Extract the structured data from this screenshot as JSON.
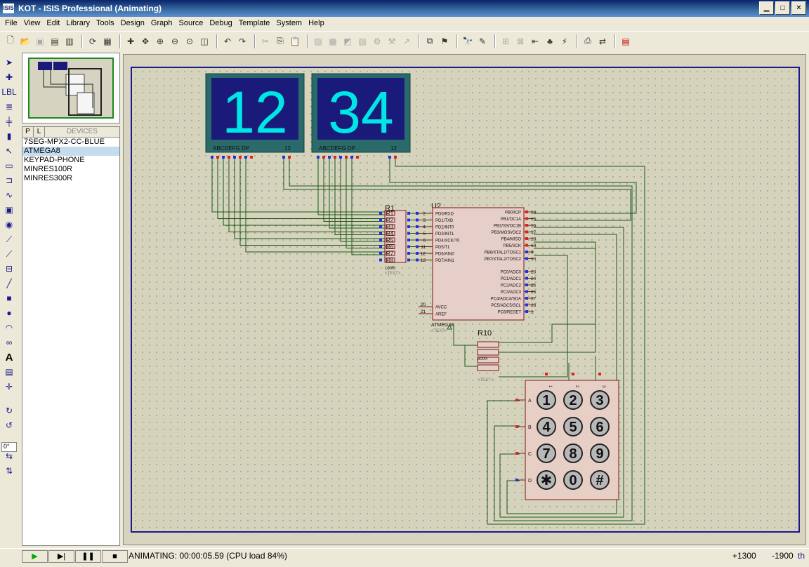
{
  "window": {
    "title": "KOT - ISIS Professional (Animating)",
    "app_icon_text": "ISIS"
  },
  "menu": [
    "File",
    "View",
    "Edit",
    "Library",
    "Tools",
    "Design",
    "Graph",
    "Source",
    "Debug",
    "Template",
    "System",
    "Help"
  ],
  "device_panel": {
    "tab_p": "P",
    "tab_l": "L",
    "header": "DEVICES",
    "items": [
      "7SEG-MPX2-CC-BLUE",
      "ATMEGA8",
      "KEYPAD-PHONE",
      "MINRES100R",
      "MINRES300R"
    ],
    "selected": "ATMEGA8"
  },
  "rotation": "0°",
  "schematic": {
    "display1_digits": "12",
    "display2_digits": "34",
    "display_pin_label": "ABCDEFG  DP",
    "display_pin_label2": "12",
    "r1_label": "R1",
    "r_pins": [
      "R1",
      "R2",
      "R3",
      "R4",
      "R5",
      "R6",
      "R7",
      "R8"
    ],
    "r1_value": "100R",
    "u2_label": "U2",
    "u2_part": "ATMEGA8",
    "text_placeholder": "<TEXT>",
    "r10_label": "R10",
    "r10_value": "300R",
    "left_pins": [
      {
        "num": "2",
        "name": "PD0/RXD"
      },
      {
        "num": "3",
        "name": "PD1/TXD"
      },
      {
        "num": "4",
        "name": "PD2/INT0"
      },
      {
        "num": "5",
        "name": "PD3/INT1"
      },
      {
        "num": "6",
        "name": "PD4/XCK/T0"
      },
      {
        "num": "11",
        "name": "PD5/T1"
      },
      {
        "num": "12",
        "name": "PD6/AIN0"
      },
      {
        "num": "13",
        "name": "PD7/AIN1"
      }
    ],
    "power_pins": [
      {
        "num": "20",
        "name": "AVCC"
      },
      {
        "num": "21",
        "name": "AREF"
      }
    ],
    "right_pins": [
      {
        "num": "14",
        "name": "PB0/ICP"
      },
      {
        "num": "15",
        "name": "PB1/OC1A"
      },
      {
        "num": "16",
        "name": "PB2/SS/OC1B"
      },
      {
        "num": "17",
        "name": "PB3/MOSI/OC2"
      },
      {
        "num": "18",
        "name": "PB4/MISO"
      },
      {
        "num": "19",
        "name": "PB5/SCK"
      },
      {
        "num": "9",
        "name": "PB6/XTAL1/TOSC1"
      },
      {
        "num": "10",
        "name": "PB7/XTAL2/TOSC2"
      },
      {
        "num": "23",
        "name": "PC0/ADC0"
      },
      {
        "num": "24",
        "name": "PC1/ADC1"
      },
      {
        "num": "25",
        "name": "PC2/ADC2"
      },
      {
        "num": "26",
        "name": "PC3/ADC3"
      },
      {
        "num": "27",
        "name": "PC4/ADC4/SDA"
      },
      {
        "num": "28",
        "name": "PC5/ADC5/SCL"
      },
      {
        "num": "1",
        "name": "PC6/RESET"
      }
    ],
    "keypad_rows": [
      "A",
      "B",
      "C",
      "D"
    ],
    "keypad_cols": [
      "1",
      "2",
      "3"
    ],
    "keys": [
      "1",
      "2",
      "3",
      "4",
      "5",
      "6",
      "7",
      "8",
      "9",
      "✱",
      "0",
      "#"
    ]
  },
  "status": {
    "message": "ANIMATING: 00:00:05.59 (CPU load 84%)",
    "coord_x": "+1300",
    "coord_y": "-1900",
    "units": "th"
  },
  "colors": {
    "wire": "#1a5a1a",
    "sheet_border": "#1a1a8a",
    "segment": "#00e5e5",
    "display_bg": "#1a1a7a",
    "display_frame": "#2a6a6a",
    "chip_fill": "#e6cfc8",
    "chip_border": "#7a1a1a",
    "keypad_fill": "#e8cfc6"
  }
}
